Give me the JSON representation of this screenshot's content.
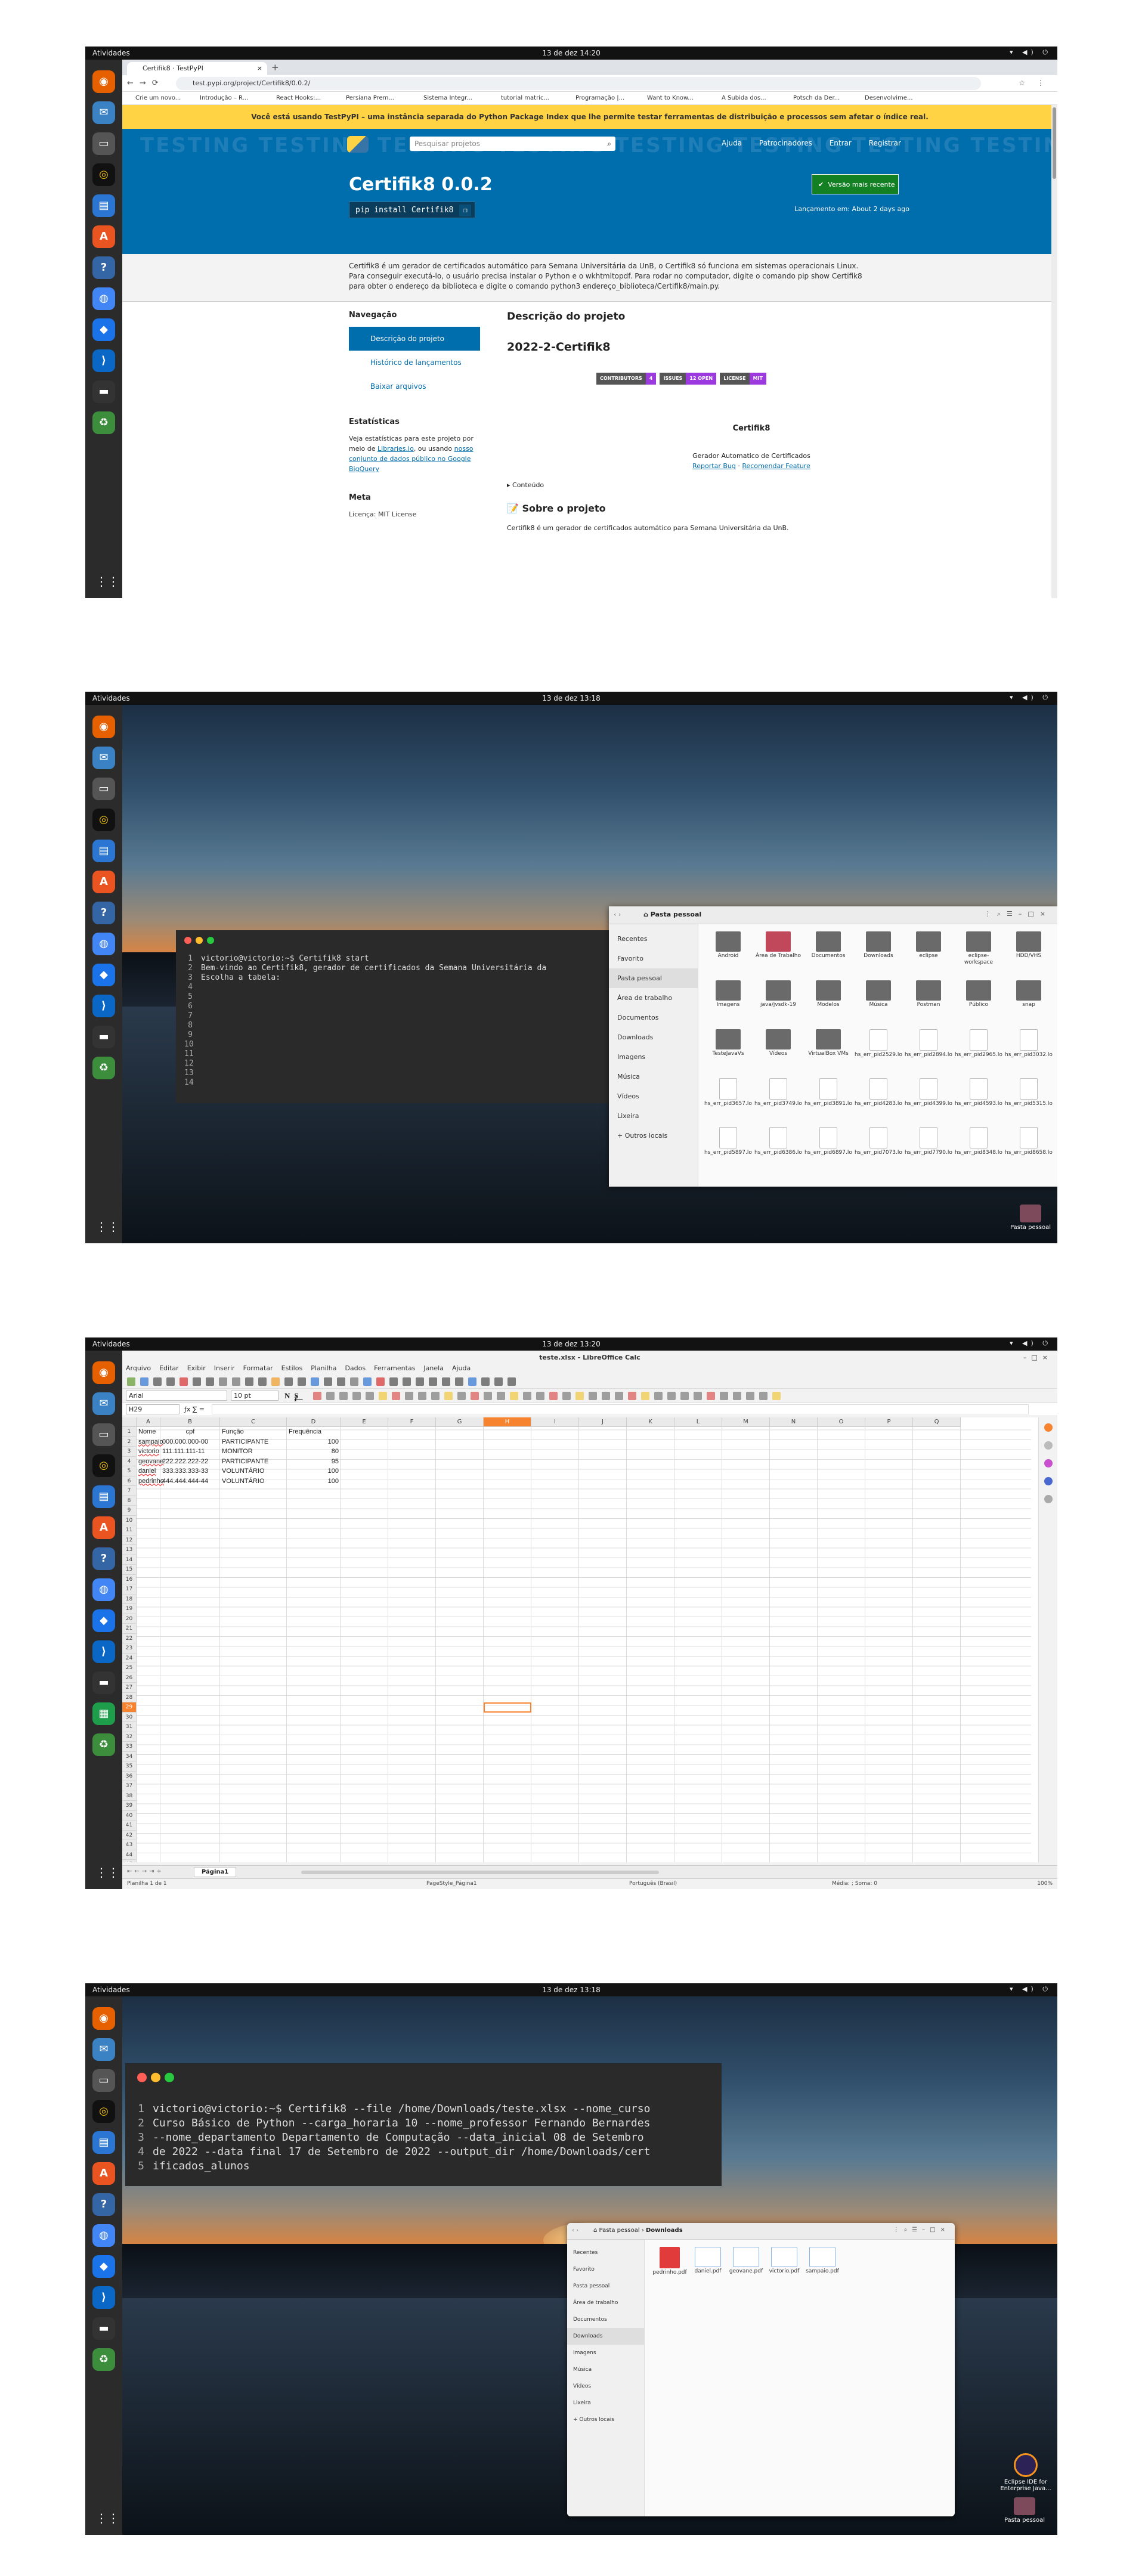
{
  "topbar": {
    "activities": "Atividades",
    "clock1": "13 de dez  14:20",
    "clock2": "13 de dez  13:18",
    "clock3": "13 de dez  13:20",
    "clock4": "13 de dez  13:18"
  },
  "browser": {
    "tab_title": "Certifik8 · TestPyPI",
    "url": "test.pypi.org/project/Certifik8/0.0.2/",
    "bookmarks": [
      "Crie um novo...",
      "Introdução – R...",
      "React Hooks:...",
      "Persiana Prem...",
      "Sistema Integr...",
      "tutorial matric...",
      "Programação |...",
      "Want to Know...",
      "A Subida dos...",
      "Potsch da Der...",
      "Desenvolvime..."
    ]
  },
  "pypi": {
    "warning": "Você está usando TestPyPI – uma instância separada do Python Package Index que lhe permite testar ferramentas de distribuição e processos sem afetar o índice real.",
    "bg_text": "TESTING  TESTING  TESTING  TESTING  TESTING  TESTING  TESTING  TESTING",
    "search_placeholder": "Pesquisar projetos",
    "links": [
      "Ajuda",
      "Patrocinadores",
      "Entrar",
      "Registrar"
    ],
    "title": "Certifik8 0.0.2",
    "pip": "pip install Certifik8",
    "latest_btn": "Versão mais recente",
    "released": "Lançamento em: About 2 days ago",
    "desc": [
      "Certifik8 é um gerador de certificados automático para Semana Universitária da UnB, o Certifik8 só funciona em sistemas operacionais Linux.",
      "Para conseguir executá-lo, o usuário precisa instalar o Python e o wkhtmltopdf. Para rodar no computador, digite o comando pip show Certifik8",
      "para obter o endereço da biblioteca e digite o comando python3 endereço_biblioteca/Certifik8/main.py."
    ],
    "nav_heading": "Navegação",
    "nav_items": [
      "Descrição do projeto",
      "Histórico de lançamentos",
      "Baixar arquivos"
    ],
    "stats_heading": "Estatísticas",
    "stats_text1": "Veja estatísticas para este projeto por meio de ",
    "stats_link1": "Libraries.io",
    "stats_text2": ", ou usando ",
    "stats_link2": "nosso conjunto de dados público no Google BigQuery",
    "meta_heading": "Meta",
    "license": "Licença: MIT License",
    "main_heading": "Descrição do projeto",
    "project_h": "2022-2-Certifik8",
    "badges": [
      {
        "l": "CONTRIBUTORS",
        "v": "4"
      },
      {
        "l": "ISSUES",
        "v": "12 OPEN"
      },
      {
        "l": "LICENSE",
        "v": "MIT"
      }
    ],
    "cert_title": "Certifik8",
    "gerador": "Gerador Automatico de Certificados",
    "bug": "Reportar Bug",
    "feature": "Recomendar Feature",
    "sep": " · ",
    "conteudo": "▸ Conteúdo",
    "sobre": "📝 Sobre o projeto",
    "sobre_txt": "Certifik8 é um gerador de certificados automático para Semana Universitária da UnB."
  },
  "term1": {
    "lines": [
      "victorio@victorio:~$ Certifik8 start",
      "Bem-vindo ao Certifik8, gerador de certificados da Semana Universitária da",
      "Escolha a tabela:",
      "",
      "",
      "",
      "",
      "",
      "",
      "",
      "",
      "",
      "",
      ""
    ]
  },
  "fm1": {
    "title": "Pasta pessoal",
    "side": [
      "Recentes",
      "Favorito",
      "Pasta pessoal",
      "Área de trabalho",
      "Documentos",
      "Downloads",
      "Imagens",
      "Música",
      "Vídeos",
      "Lixeira",
      "+  Outros locais"
    ],
    "files": [
      "Android",
      "Área de Trabalho",
      "Documentos",
      "Downloads",
      "eclipse",
      "eclipse-workspace",
      "HDD/VHS",
      "Imagens",
      "java/jvsdk-19",
      "Modelos",
      "Música",
      "Postman",
      "Público",
      "snap",
      "TesteJavaVs",
      "Vídeos",
      "VirtualBox VMs",
      "hs_err_pid2529.log",
      "hs_err_pid2894.log",
      "hs_err_pid2965.log",
      "hs_err_pid3032.log",
      "hs_err_pid3657.log",
      "hs_err_pid3749.log",
      "hs_err_pid3891.log",
      "hs_err_pid4283.log",
      "hs_err_pid4399.log",
      "hs_err_pid4593.log",
      "hs_err_pid5315.log",
      "hs_err_pid5897.log",
      "hs_err_pid6386.log",
      "hs_err_pid6897.log",
      "hs_err_pid7073.log",
      "hs_err_pid7790.log",
      "hs_err_pid8348.log",
      "hs_err_pid8658.log"
    ]
  },
  "desktop": {
    "home_label": "Pasta pessoal",
    "eclipse_label": "Eclipse IDE for Enterprise Java..."
  },
  "calc": {
    "title": "teste.xlsx - LibreOffice Calc",
    "menu": [
      "Arquivo",
      "Editar",
      "Exibir",
      "Inserir",
      "Formatar",
      "Estilos",
      "Planilha",
      "Dados",
      "Ferramentas",
      "Janela",
      "Ajuda"
    ],
    "font": "Arial",
    "size": "10 pt",
    "cellref": "H29",
    "formula": "",
    "cols": [
      "A",
      "B",
      "C",
      "D",
      "E",
      "F",
      "G",
      "H",
      "I",
      "J",
      "K",
      "L",
      "M",
      "N",
      "O",
      "P",
      "Q"
    ],
    "rows": [
      [
        "Nome",
        "cpf",
        "Função",
        "Frequência"
      ],
      [
        "sampaio",
        "000.000.000-00",
        "PARTICIPANTE",
        "100"
      ],
      [
        "victorio",
        "111.111.111-11",
        "MONITOR",
        "80"
      ],
      [
        "geovane",
        "222.222.222-22",
        "PARTICIPANTE",
        "95"
      ],
      [
        "daniel",
        "333.333.333-33",
        "VOLUNTÁRIO",
        "100"
      ],
      [
        "pedrinho",
        "444.444.444-44",
        "VOLUNTÁRIO",
        "100"
      ]
    ],
    "sheet_tab": "Página1",
    "status_left": "Planilha 1 de 1",
    "status_style": "PageStyle_Página1",
    "status_lang": "Português (Brasil)",
    "status_avg": "Média: ; Soma: 0",
    "zoom": "100%"
  },
  "term2": {
    "lines": [
      "victorio@victorio:~$ Certifik8 --file /home/Downloads/teste.xlsx --nome_curso",
      "Curso Básico de Python --carga_horaria 10 --nome_professor Fernando Bernardes",
      "--nome_departamento Departamento de Computação --data_inicial 08 de Setembro",
      "de 2022 --data final 17 de Setembro de 2022 --output_dir /home/Downloads/cert",
      "ificados_alunos"
    ]
  },
  "fm2": {
    "path_home": "Pasta pessoal",
    "path_dl": "Downloads",
    "side": [
      "Recentes",
      "Favorito",
      "Pasta pessoal",
      "Área de trabalho",
      "Documentos",
      "Downloads",
      "Imagens",
      "Música",
      "Vídeos",
      "Lixeira",
      "+  Outros locais"
    ],
    "files": [
      "pedrinho.pdf",
      "daniel.pdf",
      "geovane.pdf",
      "victorio.pdf",
      "sampaio.pdf"
    ]
  },
  "colors": {
    "pypi_blue": "#006dad",
    "warning_yellow": "#ffd343",
    "calc_orange": "#f8832f",
    "green": "#148024"
  }
}
